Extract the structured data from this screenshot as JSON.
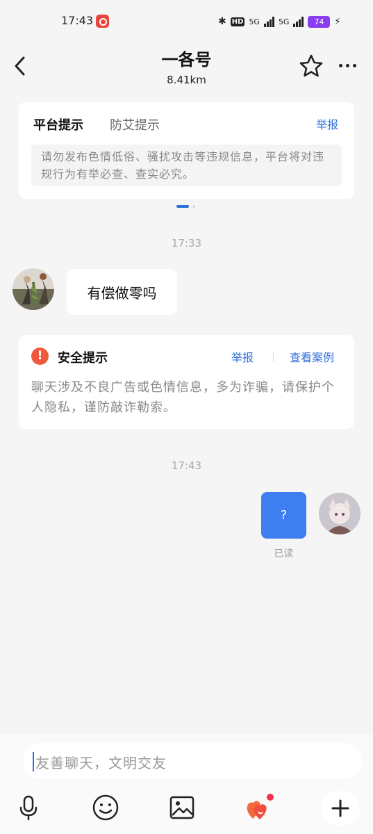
{
  "status_bar": {
    "time": "17:43",
    "hd_label": "HD",
    "network_1": "5G",
    "network_2": "5G",
    "battery": "74"
  },
  "header": {
    "title": "一各号",
    "distance": "8.41km",
    "icons": [
      "back-icon",
      "star-icon",
      "more-icon"
    ]
  },
  "notice_card": {
    "tabs": [
      "平台提示",
      "防艾提示"
    ],
    "active_tab_index": 0,
    "report_label": "举报",
    "message": "请勿发布色情低俗、骚扰攻击等违规信息，平台将对违规行为有举必查、查实必究。",
    "page_count": 2,
    "active_page": 1
  },
  "messages": [
    {
      "type": "timestamp",
      "text": "17:33"
    },
    {
      "type": "incoming",
      "text": "有偿做零吗"
    },
    {
      "type": "safety_notice",
      "title": "安全提示",
      "report_label": "举报",
      "cases_label": "查看案例",
      "body": "聊天涉及不良广告或色情信息，多为诈骗，请保护个人隐私，谨防敲诈勒索。"
    },
    {
      "type": "timestamp",
      "text": "17:43"
    },
    {
      "type": "outgoing",
      "text": "?",
      "status": "已读"
    }
  ],
  "composer": {
    "placeholder": "友善聊天，文明交友",
    "tools": [
      "microphone-icon",
      "emoji-icon",
      "image-icon",
      "gift-hearts-icon",
      "plus-icon"
    ]
  },
  "colors": {
    "accent": "#2f6fd9",
    "outgoing_bubble": "#3f7ef0",
    "warning": "#ef5a3c",
    "battery": "#8a3df0",
    "background": "#f5f5f5"
  }
}
